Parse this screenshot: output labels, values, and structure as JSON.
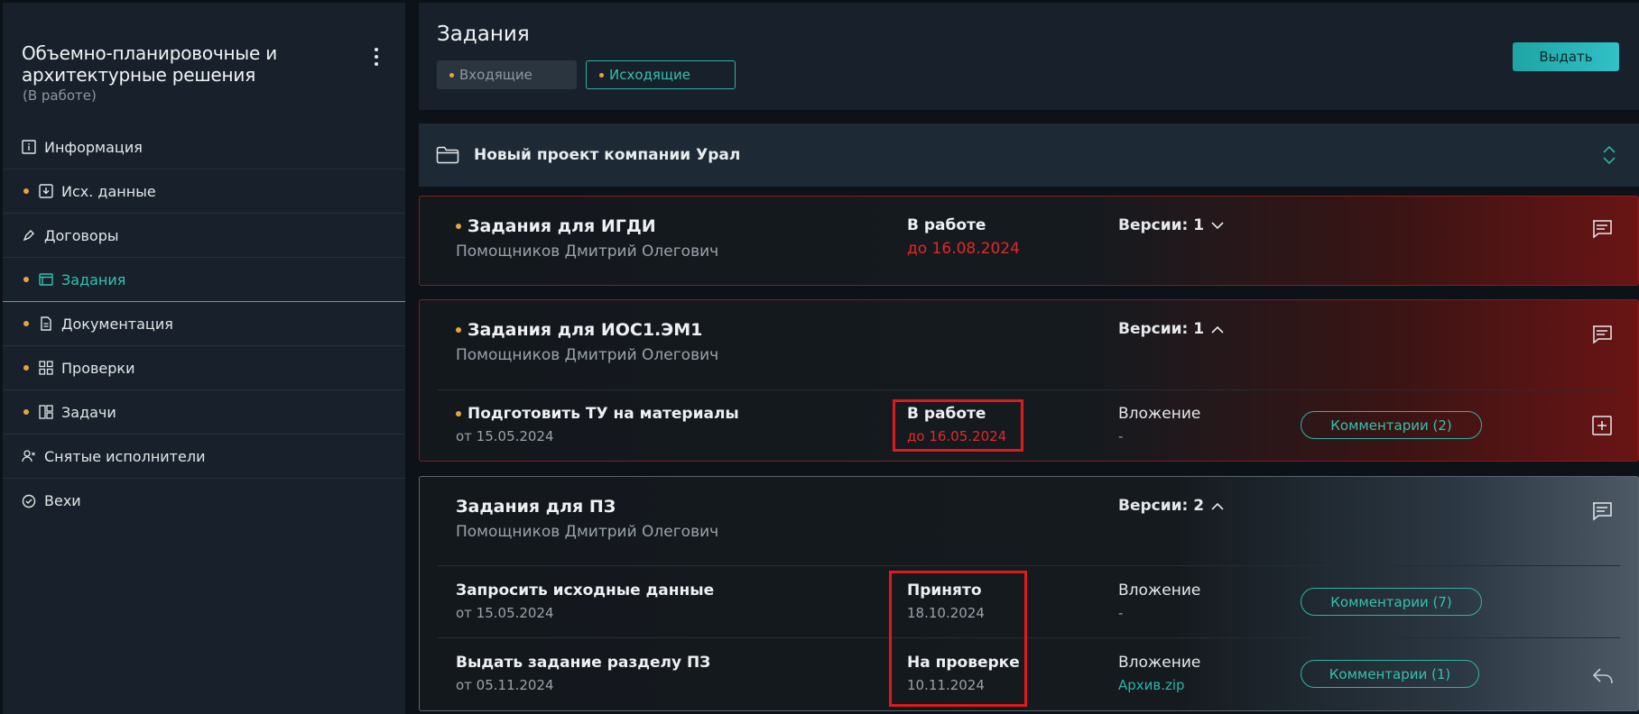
{
  "sidebar": {
    "title": "Объемно-планировочные и архитектурные решения",
    "status": "(В работе)",
    "items": [
      {
        "label": "Информация",
        "dot": false,
        "icon": "info-icon"
      },
      {
        "label": "Исх. данные",
        "dot": true,
        "icon": "download-icon"
      },
      {
        "label": "Договоры",
        "dot": false,
        "icon": "pen-icon"
      },
      {
        "label": "Задания",
        "dot": true,
        "icon": "window-icon",
        "active": true
      },
      {
        "label": "Документация",
        "dot": true,
        "icon": "document-icon"
      },
      {
        "label": "Проверки",
        "dot": true,
        "icon": "grid-icon"
      },
      {
        "label": "Задачи",
        "dot": true,
        "icon": "board-icon"
      },
      {
        "label": "Снятые исполнители",
        "dot": false,
        "icon": "user-remove-icon"
      },
      {
        "label": "Вехи",
        "dot": false,
        "icon": "check-circle-icon"
      }
    ]
  },
  "header": {
    "title": "Задания",
    "tabs": [
      "Входящие",
      "Исходящие"
    ],
    "issue_label": "Выдать"
  },
  "project": {
    "name": "Новый проект компании Урал"
  },
  "cards": [
    {
      "title": "Задания для ИГДИ",
      "author": "Помощников Дмитрий Олегович",
      "status": "В работе",
      "deadline": "до 16.08.2024",
      "versions": "Версии: 1"
    },
    {
      "title": "Задания для ИОС1.ЭМ1",
      "author": "Помощников Дмитрий Олегович",
      "versions": "Версии: 1",
      "tasks": [
        {
          "title": "Подготовить ТУ на материалы",
          "date": "от 15.05.2024",
          "status": "В работе",
          "status_date": "до 16.05.2024",
          "attachment_label": "Вложение",
          "attachment": "-",
          "comments": "Комментарии (2)"
        }
      ]
    },
    {
      "title": "Задания для ПЗ",
      "author": "Помощников Дмитрий Олегович",
      "versions": "Версии: 2",
      "tasks": [
        {
          "title": "Запросить исходные данные",
          "date": "от 15.05.2024",
          "status": "Принято",
          "status_date": "18.10.2024",
          "attachment_label": "Вложение",
          "attachment": "-",
          "comments": "Комментарии (7)"
        },
        {
          "title": "Выдать задание разделу ПЗ",
          "date": "от 05.11.2024",
          "status": "На проверке",
          "status_date": "10.11.2024",
          "attachment_label": "Вложение",
          "attachment": "Архив.zip",
          "comments": "Комментарии (1)"
        }
      ]
    }
  ],
  "colors": {
    "accent": "#2bb5a5",
    "danger": "#e02929",
    "pending_dot": "#e8a53a"
  }
}
